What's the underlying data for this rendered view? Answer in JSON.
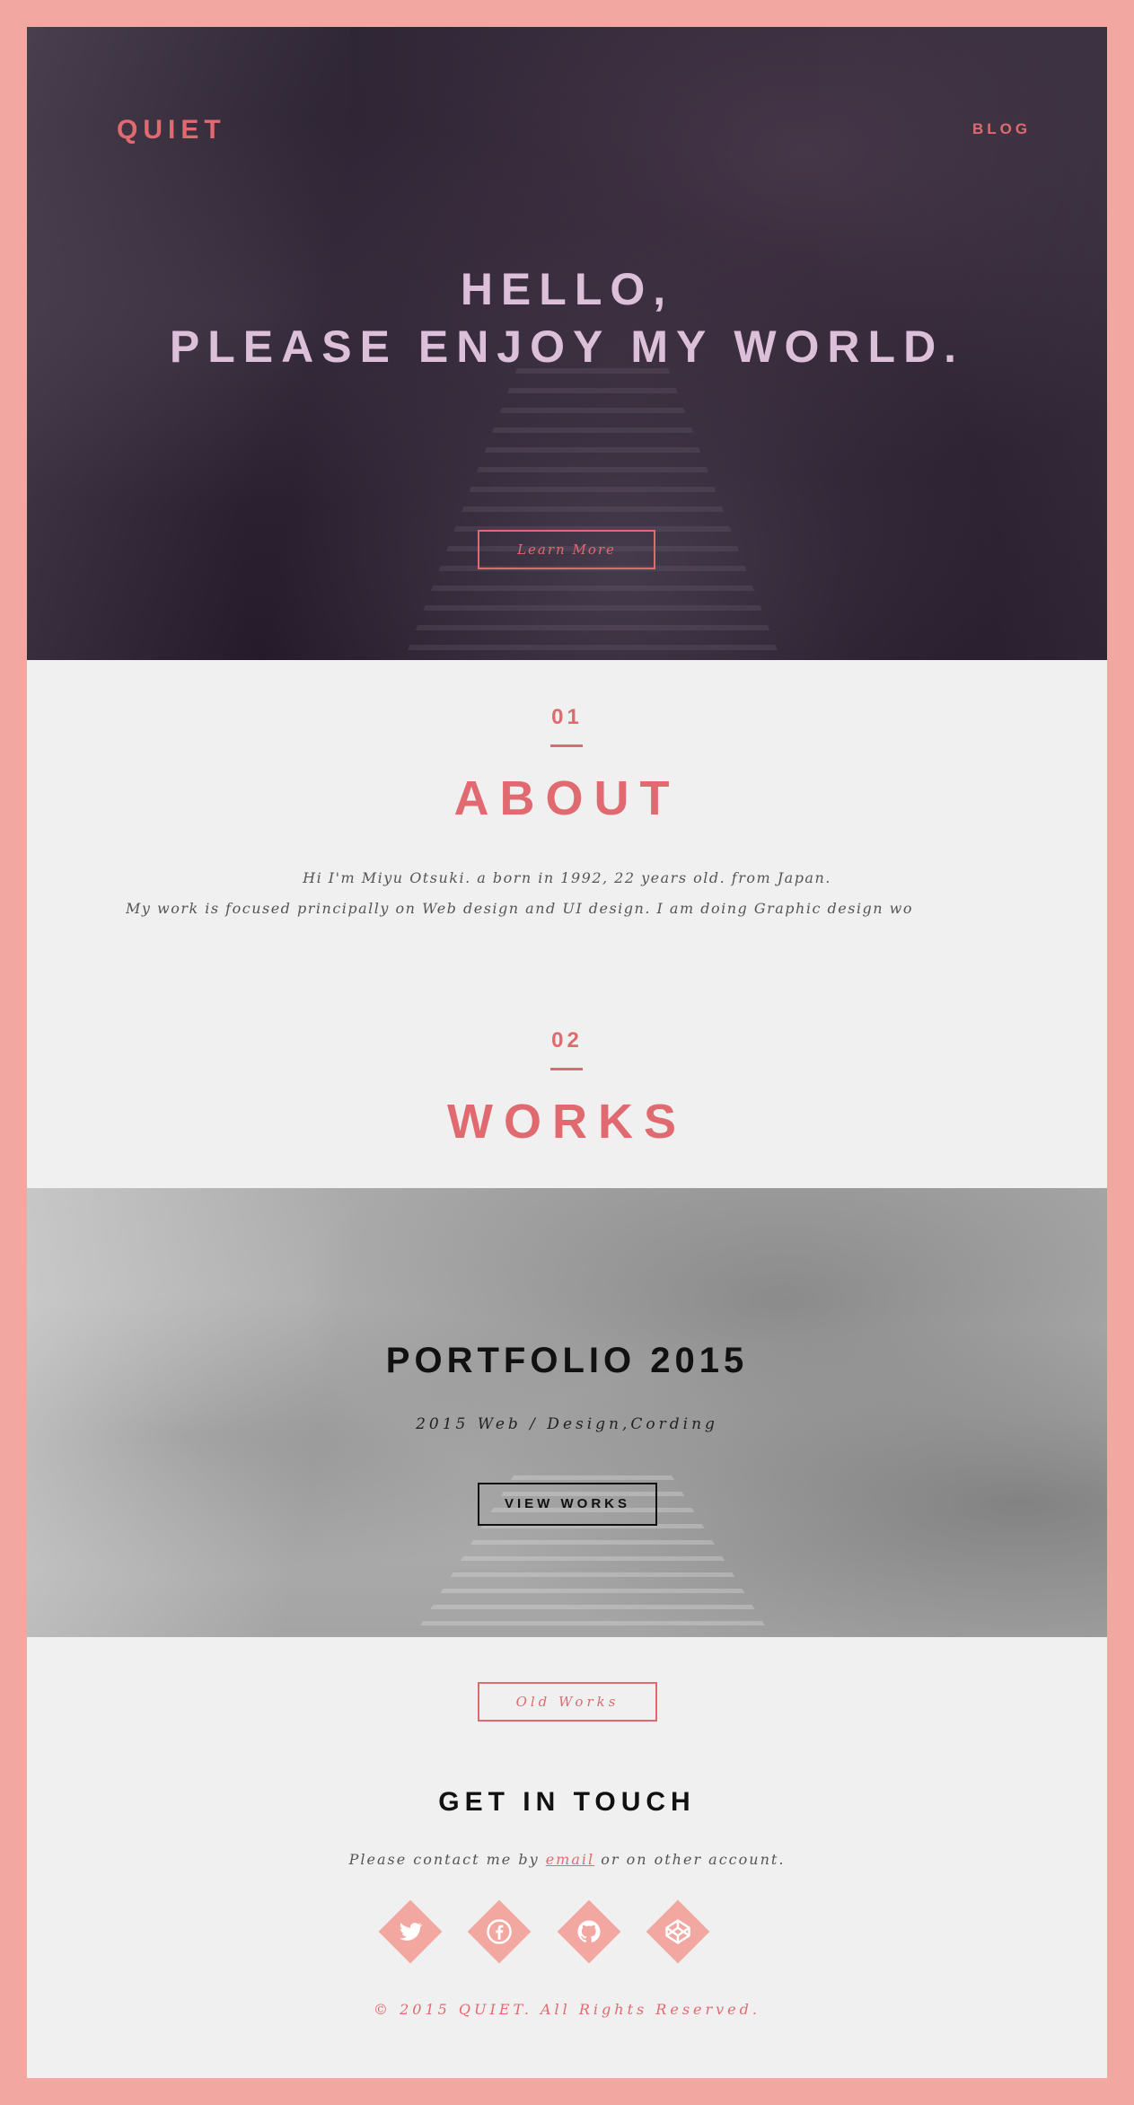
{
  "header": {
    "logo": "QUIET",
    "nav_blog": "BLOG"
  },
  "hero": {
    "title_line1": "HELLO,",
    "title_line2": "PLEASE ENJOY MY WORLD.",
    "button_label": "Learn More"
  },
  "about": {
    "number": "01",
    "title": "ABOUT",
    "line1": "Hi I'm Miyu Otsuki. a born in 1992, 22 years old. from Japan.",
    "line2": "My work is focused principally on Web design and UI design. I am doing Graphic design wo"
  },
  "works": {
    "number": "02",
    "title": "WORKS",
    "portfolio_title": "PORTFOLIO 2015",
    "portfolio_subtitle": "2015 Web / Design,Cording",
    "view_button": "VIEW WORKS",
    "old_works_button": "Old Works"
  },
  "contact": {
    "title": "GET IN TOUCH",
    "text_before": "Please contact me by",
    "link_text": "email",
    "text_after": "or on other account.",
    "social": [
      {
        "name": "twitter-icon"
      },
      {
        "name": "facebook-icon"
      },
      {
        "name": "github-icon"
      },
      {
        "name": "codepen-icon"
      }
    ]
  },
  "footer": {
    "copyright": "© 2015 QUIET. All Rights Reserved."
  },
  "colors": {
    "border": "#f2a7a0",
    "accent": "#e06a6f",
    "hero_title": "#dcc0da",
    "background": "#f0f0f0"
  }
}
